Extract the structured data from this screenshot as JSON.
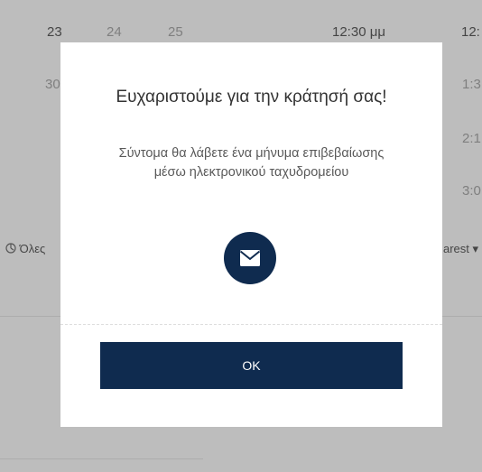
{
  "background": {
    "calendar_days": [
      "23",
      "24",
      "25"
    ],
    "calendar_day_below": "30",
    "time_slots": [
      "12:30 μμ"
    ],
    "time_fragments": [
      "12:",
      "1:3",
      "2:1",
      "3:0"
    ],
    "timezone_fragment": "Όλες",
    "timezone_icon": "globe-icon",
    "sort_fragment": "arest ▾"
  },
  "modal": {
    "title": "Ευχαριστούμε για την κράτησή σας!",
    "message": "Σύντομα θα λάβετε ένα μήνυμα επιβεβαίωσης μέσω ηλεκτρονικού ταχυδρομείου",
    "icon": "envelope-icon",
    "ok_label": "OK"
  },
  "colors": {
    "brand_navy": "#0f2b4f",
    "overlay": "#bdbdbd",
    "modal_background": "#ffffff"
  }
}
